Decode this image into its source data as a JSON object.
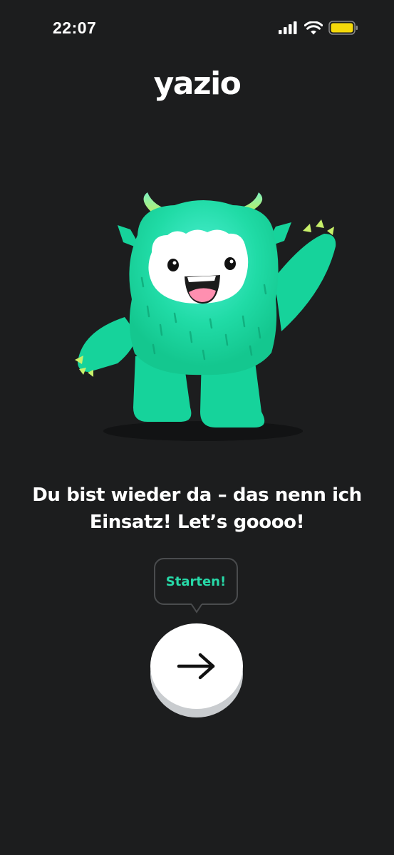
{
  "status_bar": {
    "time": "22:07",
    "icons": [
      "cellular-signal-icon",
      "wifi-icon",
      "battery-icon"
    ],
    "battery_color": "#f5d90a"
  },
  "logo": {
    "text": "yazio"
  },
  "mascot": {
    "icon": "monster-mascot-illustration",
    "body_color": "#1fd9a4",
    "horn_color": "#c8f06a"
  },
  "headline": {
    "text": "Du bist wieder da – das nenn ich Einsatz! Let’s goooo!"
  },
  "tooltip": {
    "label": "Starten!",
    "label_color": "#27d9a8"
  },
  "start_button": {
    "icon": "arrow-right-icon"
  }
}
